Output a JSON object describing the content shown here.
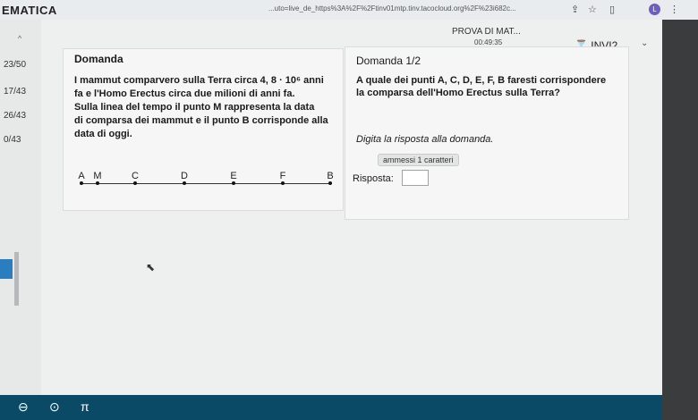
{
  "app": {
    "title": "EMATICA"
  },
  "browser": {
    "url": "...uto=live_de_https%3A%2F%2Ftinv01mtp.tinv.tacocloud.org%2F%23i682c...",
    "profile_initial": "L"
  },
  "header": {
    "test_name": "PROVA DI MAT...",
    "timer": "00:49:35",
    "user": "INVI2..."
  },
  "sidebar": {
    "items": [
      {
        "label": "23/50"
      },
      {
        "label": "17/43"
      },
      {
        "label": "26/43"
      },
      {
        "label": "0/43"
      }
    ]
  },
  "question": {
    "title": "Domanda",
    "line1": "I mammut comparvero sulla Terra circa 4, 8 · 10⁶ anni",
    "line2": "fa e l'Homo Erectus circa due milioni di anni fa.",
    "line3": "Sulla linea del tempo il punto M rappresenta la data",
    "line4": "di comparsa dei mammut e il punto B corrisponde alla",
    "line5": "data di oggi.",
    "timeline_labels": [
      "A",
      "M",
      "C",
      "D",
      "E",
      "F",
      "B"
    ]
  },
  "answer": {
    "title": "Domanda 1/2",
    "line1": "A quale dei punti A, C, D, E, F, B faresti corrispondere",
    "line2": "la comparsa dell'Homo Erectus sulla Terra?",
    "hint": "Digita la risposta alla domanda.",
    "badge": "ammessi 1 caratteri",
    "label": "Risposta:",
    "value": ""
  },
  "toolbar": {
    "pi_label": "π",
    "colors": {
      "bar": "#0a4a66",
      "accent": "#2a7ec0"
    }
  }
}
